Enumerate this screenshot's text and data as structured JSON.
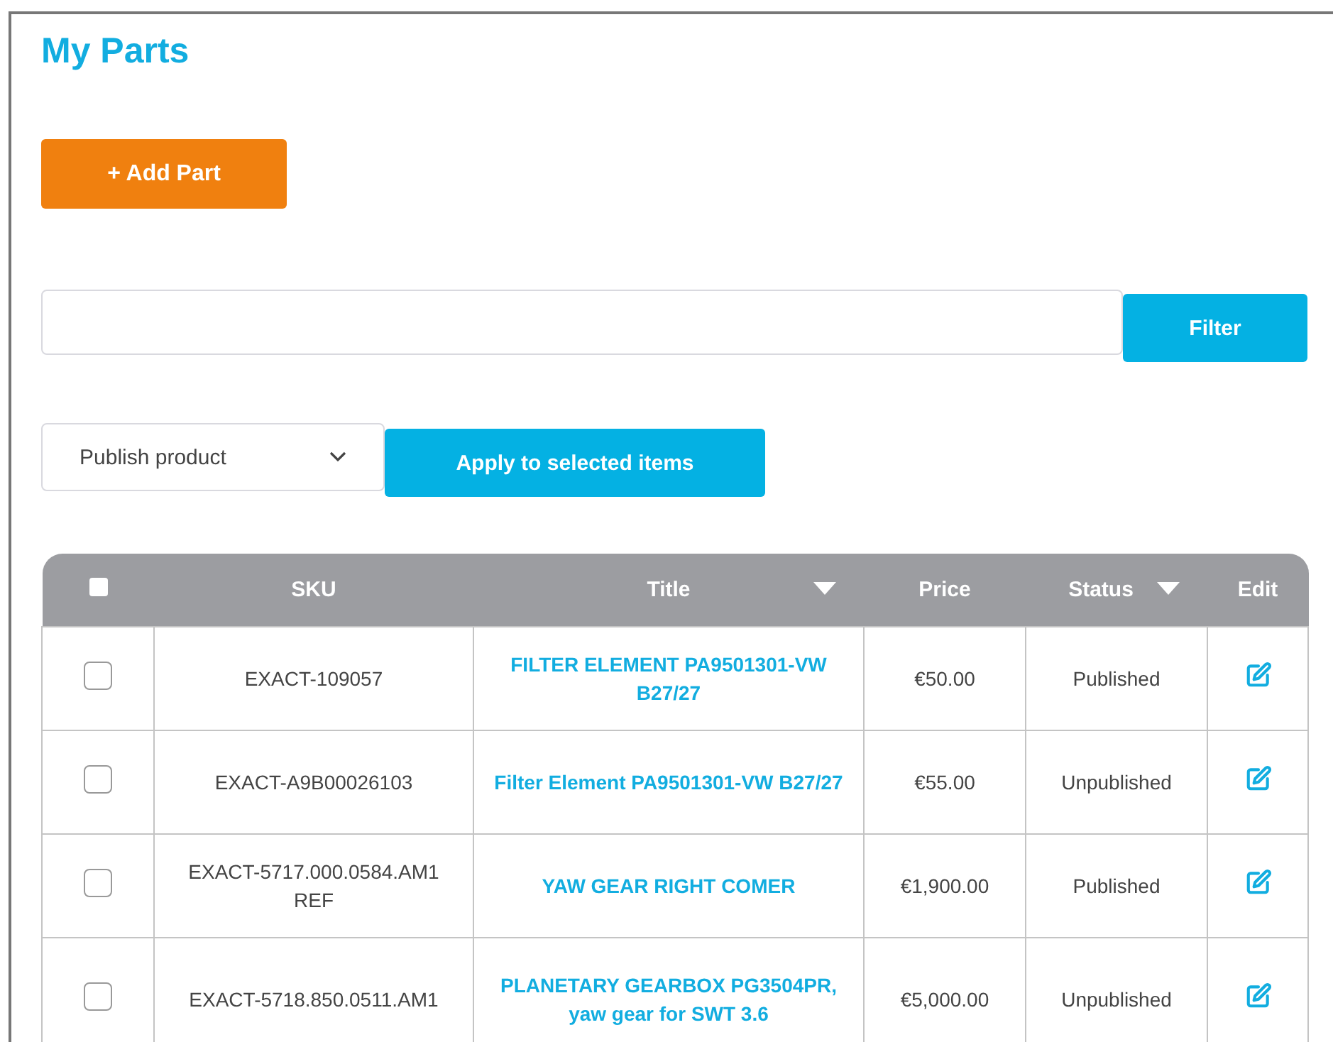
{
  "page": {
    "title": "My Parts"
  },
  "add_button": "+ Add Part",
  "filter": {
    "button": "Filter"
  },
  "bulk": {
    "action": "Publish product",
    "button": "Apply to selected items"
  },
  "table": {
    "select_all": false,
    "columns": [
      {
        "label": "SKU",
        "menu": false
      },
      {
        "label": "Title",
        "menu": true
      },
      {
        "label": "Price",
        "menu": false
      },
      {
        "label": "Status",
        "menu": true
      },
      {
        "label": "Edit",
        "menu": false
      }
    ],
    "rows": [
      {
        "checked": false,
        "sku": "EXACT-109057",
        "title": "FILTER ELEMENT PA9501301-VW B27/27",
        "price": "€50.00",
        "status": "Published"
      },
      {
        "checked": false,
        "sku": "EXACT-A9B00026103",
        "title": "Filter Element PA9501301-VW B27/27",
        "price": "€55.00",
        "status": "Unpublished"
      },
      {
        "checked": false,
        "sku": "EXACT-5717.000.0584.AM1 REF",
        "title": "YAW GEAR RIGHT COMER",
        "price": "€1,900.00",
        "status": "Published"
      },
      {
        "checked": false,
        "sku": "EXACT-5718.850.0511.AM1",
        "title": "PLANETARY GEARBOX PG3504PR, yaw gear for SWT 3.6",
        "price": "€5,000.00",
        "status": "Unpublished"
      }
    ]
  }
}
